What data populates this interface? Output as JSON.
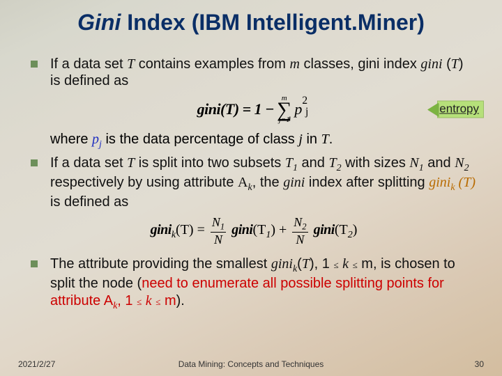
{
  "title": {
    "gini": "Gini",
    "rest": " Index (IBM Intelligent.Miner)"
  },
  "bullets": {
    "b1_a": "If a data set ",
    "b1_T": "T",
    "b1_b": " contains examples from ",
    "b1_m": "m",
    "b1_c": " classes, gini index ",
    "b1_gini": "gini",
    "b1_d": " (",
    "b1_T2": "T",
    "b1_e": ") is defined as",
    "formula1": {
      "lhs": "gini(T) = 1 −",
      "top": "m",
      "bot": "j=1",
      "p": "p",
      "exp": "2",
      "sub": "j"
    },
    "entropy": "entropy",
    "where_a": "where ",
    "where_pj": "p",
    "where_jsub": "j",
    "where_b": " is the data percentage of class ",
    "where_j": "j",
    "where_c": " in ",
    "where_T": "T",
    "where_d": ".",
    "b2_a": "If a data set ",
    "b2_T": "T",
    "b2_b": " is split into two subsets ",
    "b2_T1": "T",
    "b2_1": "1",
    "b2_c": " and ",
    "b2_T2": "T",
    "b2_2": "2",
    "b2_d": " with sizes ",
    "b2_N1": "N",
    "b2_n1s": "1",
    "b2_e": " and ",
    "b2_N2": "N",
    "b2_n2s": "2",
    "b2_f": " respectively by using attribute ",
    "b2_Ak": "A",
    "b2_ks": "k",
    "b2_g": ", the ",
    "b2_gini": "gini",
    "b2_h": " index after splitting ",
    "b2_ginik": "gini",
    "b2_ksub": "k",
    "b2_i": " (",
    "b2_T3": "T",
    "b2_j": ")",
    "b2_k": " is defined as",
    "formula2": {
      "lhs_g": "gini",
      "lhs_k": "k",
      "lhs_paren": "(T) = ",
      "n1": "N",
      "n1s": "1",
      "n": "N",
      "mid_g": "gini",
      "mid_paren": "(T",
      "mid_s": "1",
      "mid_close": ") + ",
      "n2": "N",
      "n2s": "2",
      "rhs_g": "gini",
      "rhs_paren": "(T",
      "rhs_s": "2",
      "rhs_close": ")"
    },
    "b3_a": "The attribute providing the smallest ",
    "b3_gini": "gini",
    "b3_k": "k",
    "b3_b": "(",
    "b3_T": "T",
    "b3_c": "), 1",
    "b3_le1": "≤",
    "b3_kvar": "k",
    "b3_le2": "≤",
    "b3_d": "m, is chosen to split the node (",
    "b3_red": "need to enumerate all possible splitting points for attribute A",
    "b3_redk": "k",
    "b3_red2": ", 1",
    "b3_le3": "≤",
    "b3_kvar2": "k",
    "b3_le4": "≤",
    "b3_red3": "m",
    "b3_e": ")."
  },
  "footer": {
    "date": "2021/2/27",
    "center": "Data Mining: Concepts and Techniques",
    "page": "30"
  }
}
